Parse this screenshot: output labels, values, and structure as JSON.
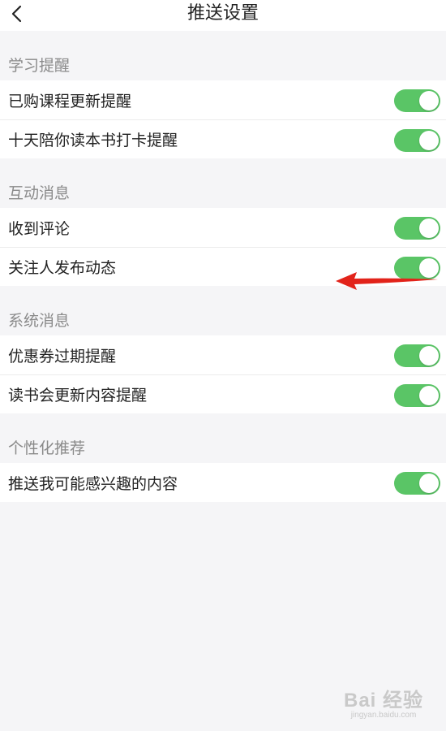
{
  "header": {
    "title": "推送设置",
    "back_icon": "chevron-left-icon"
  },
  "colors": {
    "toggle_on": "#5ac566",
    "section_header_text": "#8a8a8a",
    "annotation_arrow": "#e2231a"
  },
  "sections": [
    {
      "title": "学习提醒",
      "items": [
        {
          "label": "已购课程更新提醒",
          "enabled": true
        },
        {
          "label": "十天陪你读本书打卡提醒",
          "enabled": true
        }
      ]
    },
    {
      "title": "互动消息",
      "items": [
        {
          "label": "收到评论",
          "enabled": true
        },
        {
          "label": "关注人发布动态",
          "enabled": true
        }
      ]
    },
    {
      "title": "系统消息",
      "items": [
        {
          "label": "优惠券过期提醒",
          "enabled": true
        },
        {
          "label": "读书会更新内容提醒",
          "enabled": true
        }
      ]
    },
    {
      "title": "个性化推荐",
      "items": [
        {
          "label": "推送我可能感兴趣的内容",
          "enabled": true
        }
      ]
    }
  ],
  "watermark": {
    "main": "Bai 经验",
    "sub": "jingyan.baidu.com"
  }
}
